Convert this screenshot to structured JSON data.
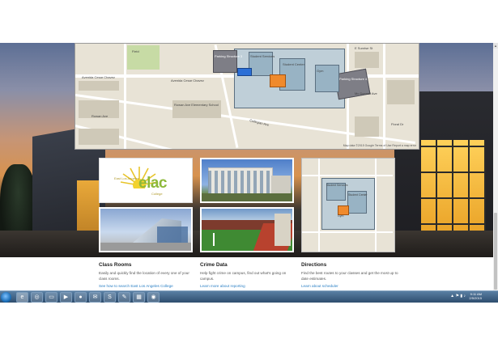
{
  "hero": {
    "map": {
      "streets": [
        "Avenida Cesar Chavez",
        "Avenida Cesar Chavez",
        "Bleakwood Ave",
        "Collegian Ave",
        "Floral Dr",
        "Mc Donnell Ave",
        "Rowan Ave",
        "Atlantic Blvd",
        "E Sunrise St",
        "Fremont Ave"
      ],
      "places": [
        "Parking Structure 3",
        "Parking Structure 4",
        "Student Services",
        "Student Center",
        "Stadium",
        "Field",
        "Rowan Ave Elementary School",
        "Gym"
      ],
      "attribution": "Map data ©2015 Google   Terms of Use   Report a map error"
    },
    "tiles": {
      "logo": {
        "brand": "elac",
        "tag": "East Los Angeles",
        "sub": "College"
      },
      "thumb_map": {
        "labels": [
          "Student Services",
          "Student Center",
          "Gym"
        ]
      }
    }
  },
  "info": [
    {
      "heading": "Class Rooms",
      "text": "Easily and quickly find the location of every one of your class rooms.",
      "link": "See how to search East Los Angeles College"
    },
    {
      "heading": "Crime Data",
      "text": "Help fight crime on campus, find out what's going on campus.",
      "link": "Learn more about reporting"
    },
    {
      "heading": "Directions",
      "text": "Find the best routes to your classes and get the most up to date estimates.",
      "link": "Learn about scheduler"
    }
  ],
  "taskbar": {
    "time": "9:11 AM",
    "date": "2/5/2015",
    "apps": [
      "ie-icon",
      "chrome-icon",
      "folder-icon",
      "media-icon",
      "firefox-icon",
      "outlook-icon",
      "skype-icon",
      "paint-icon",
      "calculator-icon",
      "chrome2-icon"
    ]
  },
  "colors": {
    "link": "#2a7fc4",
    "brand_green": "#8db93a",
    "taskbar": "#2b4a6b"
  }
}
